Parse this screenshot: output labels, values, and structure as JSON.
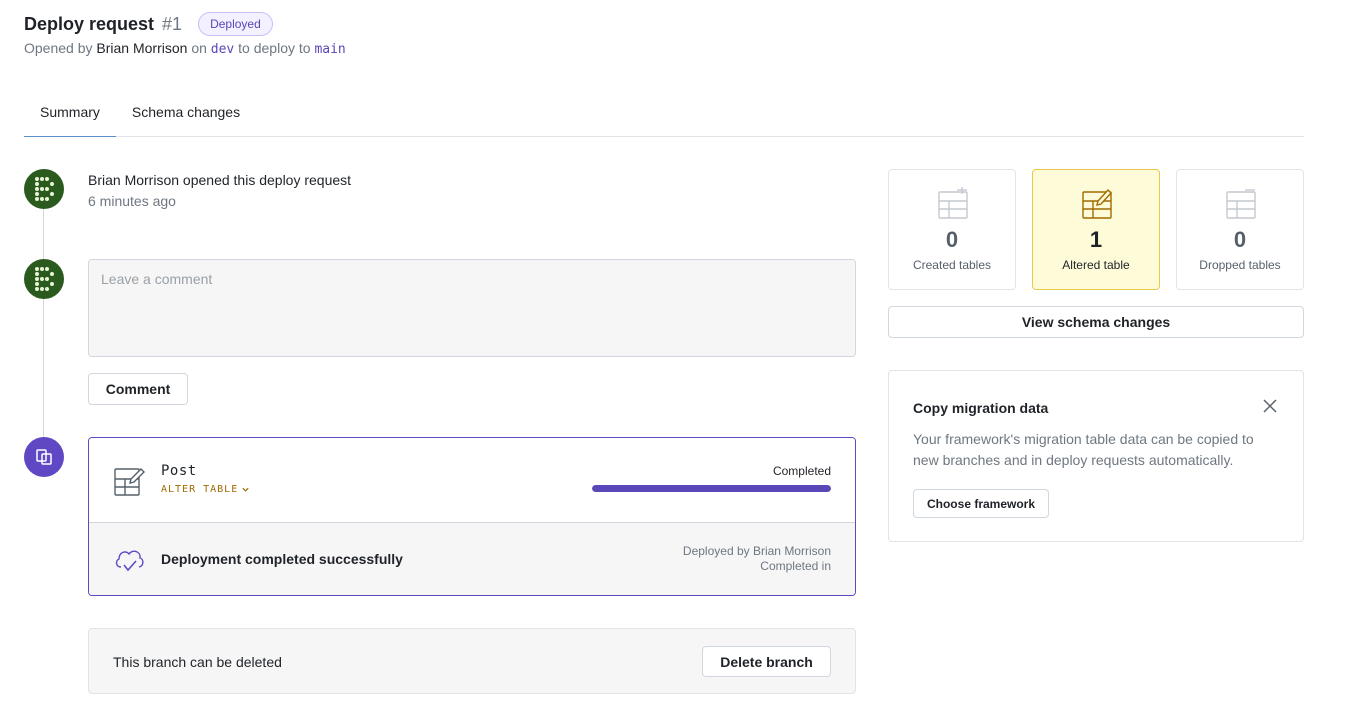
{
  "header": {
    "title": "Deploy request",
    "number": "#1",
    "badge": "Deployed",
    "opened_prefix": "Opened by",
    "author": "Brian Morrison",
    "on_text": "on",
    "source_branch": "dev",
    "to_text": "to deploy to",
    "target_branch": "main"
  },
  "tabs": [
    {
      "label": "Summary",
      "active": true
    },
    {
      "label": "Schema changes",
      "active": false
    }
  ],
  "timeline": {
    "opened_author": "Brian Morrison",
    "opened_action": "opened this deploy request",
    "opened_time": "6 minutes ago",
    "comment_placeholder": "Leave a comment",
    "comment_button": "Comment"
  },
  "deployment": {
    "table_name": "Post",
    "operation": "ALTER TABLE",
    "status": "Completed",
    "progress": 1.0,
    "result": "Deployment completed successfully",
    "deployed_by": "Deployed by Brian Morrison",
    "completed_in": "Completed in"
  },
  "branch": {
    "message": "This branch can be deleted",
    "delete_button": "Delete branch"
  },
  "stats": [
    {
      "count": "0",
      "label": "Created tables",
      "icon": "table-plus-icon"
    },
    {
      "count": "1",
      "label": "Altered table",
      "icon": "table-edit-icon",
      "highlight": true
    },
    {
      "count": "0",
      "label": "Dropped tables",
      "icon": "table-minus-icon"
    }
  ],
  "view_schema_button": "View schema changes",
  "migration": {
    "title": "Copy migration data",
    "description": "Your framework's migration table data can be copied to new branches and in deploy requests automatically.",
    "button": "Choose framework"
  },
  "colors": {
    "accent": "#6048c5",
    "highlight_bg": "#fefbd8",
    "highlight_border": "#e8c94e",
    "operation": "#a06a00"
  }
}
